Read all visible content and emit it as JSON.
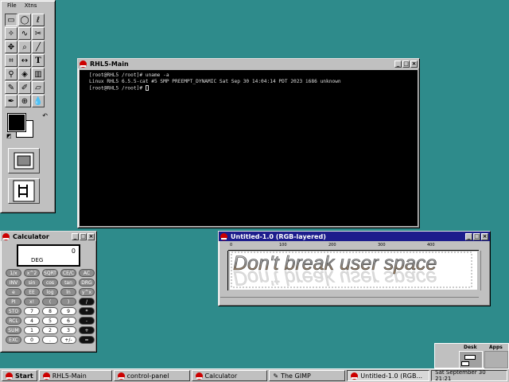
{
  "toolbox": {
    "menu": [
      "File",
      "Xtns"
    ],
    "tools": [
      "rect-select",
      "ellipse-select",
      "lasso",
      "magic-wand",
      "bezier",
      "scissors",
      "move",
      "magnify",
      "crop",
      "transform",
      "flip",
      "text",
      "color-picker",
      "bucket-fill",
      "blend",
      "pencil",
      "paintbrush",
      "eraser",
      "airbrush",
      "clone",
      "convolve"
    ]
  },
  "terminal": {
    "title": "RHL5-Main",
    "lines": [
      "[root@RHL5 /root]# uname -a",
      "Linux RHL5 6.5.5-cat #5 SMP PREEMPT_DYNAMIC Sat Sep 30 14:04:14 PDT 2023 i686 unknown",
      "[root@RHL5 /root]# "
    ]
  },
  "calculator": {
    "title": "Calculator",
    "display_value": "0",
    "mode": "DEG",
    "keys": [
      {
        "label": "1/x",
        "kind": "fn"
      },
      {
        "label": "x^2",
        "kind": "fn"
      },
      {
        "label": "SQRT",
        "kind": "fn"
      },
      {
        "label": "CE/C",
        "kind": "fn"
      },
      {
        "label": "AC",
        "kind": "fn"
      },
      {
        "label": "INV",
        "kind": "fn"
      },
      {
        "label": "sin",
        "kind": "fn"
      },
      {
        "label": "cos",
        "kind": "fn"
      },
      {
        "label": "tan",
        "kind": "fn"
      },
      {
        "label": "DRG",
        "kind": "fn"
      },
      {
        "label": "e",
        "kind": "fn"
      },
      {
        "label": "EE",
        "kind": "fn"
      },
      {
        "label": "log",
        "kind": "fn"
      },
      {
        "label": "ln",
        "kind": "fn"
      },
      {
        "label": "y^x",
        "kind": "fn"
      },
      {
        "label": "PI",
        "kind": "fn"
      },
      {
        "label": "x!",
        "kind": "fn"
      },
      {
        "label": "(",
        "kind": "fn"
      },
      {
        "label": ")",
        "kind": "fn"
      },
      {
        "label": "/",
        "kind": "op"
      },
      {
        "label": "STO",
        "kind": "fn"
      },
      {
        "label": "7",
        "kind": "num"
      },
      {
        "label": "8",
        "kind": "num"
      },
      {
        "label": "9",
        "kind": "num"
      },
      {
        "label": "*",
        "kind": "op"
      },
      {
        "label": "RCL",
        "kind": "fn"
      },
      {
        "label": "4",
        "kind": "num"
      },
      {
        "label": "5",
        "kind": "num"
      },
      {
        "label": "6",
        "kind": "num"
      },
      {
        "label": "-",
        "kind": "op"
      },
      {
        "label": "SUM",
        "kind": "fn"
      },
      {
        "label": "1",
        "kind": "num"
      },
      {
        "label": "2",
        "kind": "num"
      },
      {
        "label": "3",
        "kind": "num"
      },
      {
        "label": "+",
        "kind": "op"
      },
      {
        "label": "EXC",
        "kind": "fn"
      },
      {
        "label": "0",
        "kind": "num"
      },
      {
        "label": ".",
        "kind": "num"
      },
      {
        "label": "+/-",
        "kind": "num"
      },
      {
        "label": "=",
        "kind": "op"
      }
    ]
  },
  "gimp_image": {
    "title": "Untitled-1.0 (RGB-layered)",
    "ruler_ticks": [
      "0",
      "100",
      "200",
      "300",
      "400"
    ],
    "canvas_text": "Don't break user space"
  },
  "pager": {
    "tabs": [
      "Desk",
      "Apps"
    ]
  },
  "taskbar": {
    "start_label": "Start",
    "tasks": [
      {
        "label": "RHL5-Main",
        "pressed": false
      },
      {
        "label": "control-panel",
        "pressed": false
      },
      {
        "label": "Calculator",
        "pressed": false
      },
      {
        "label": "The GIMP",
        "pressed": false
      },
      {
        "label": "Untitled-1.0 (RGB...",
        "pressed": true
      }
    ],
    "clock": "Sat September 30 21:21"
  },
  "colors": {
    "desktop": "#2e8b8b",
    "active_title": "#1c1c8c"
  }
}
